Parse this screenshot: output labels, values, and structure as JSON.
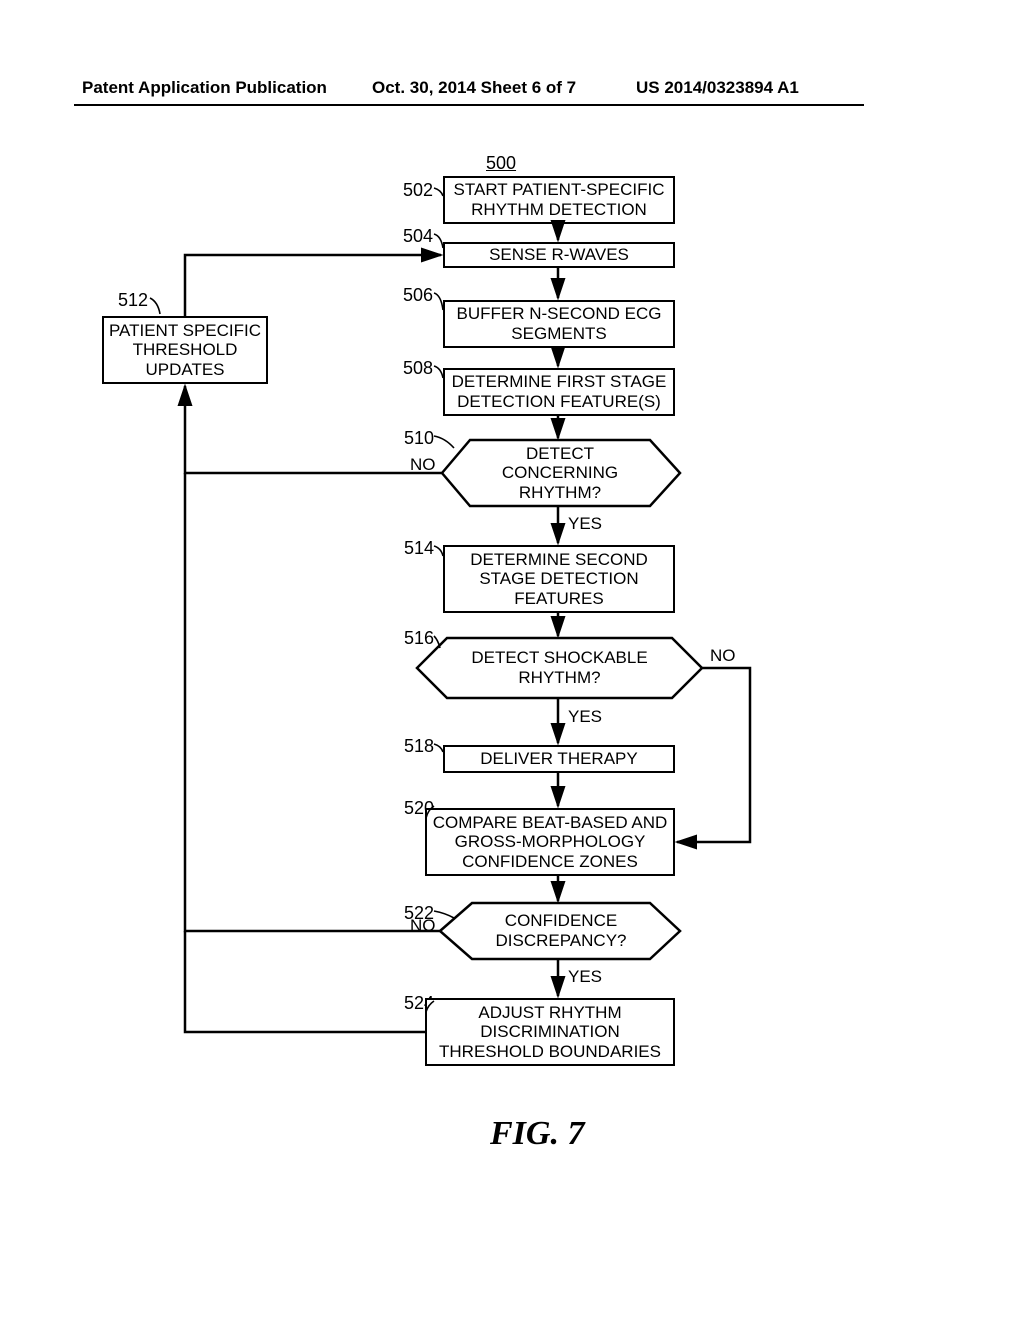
{
  "header": {
    "left": "Patent Application Publication",
    "center": "Oct. 30, 2014  Sheet 6 of 7",
    "right": "US 2014/0323894 A1"
  },
  "refs": {
    "r500": "500",
    "r502": "502",
    "r504": "504",
    "r506": "506",
    "r508": "508",
    "r510": "510",
    "r512": "512",
    "r514": "514",
    "r516": "516",
    "r518": "518",
    "r520": "520",
    "r522": "522",
    "r524": "524"
  },
  "boxes": {
    "b502": "START PATIENT-SPECIFIC RHYTHM DETECTION",
    "b504": "SENSE R-WAVES",
    "b506": "BUFFER N-SECOND ECG SEGMENTS",
    "b508": "DETERMINE FIRST STAGE DETECTION FEATURE(S)",
    "b510": "DETECT CONCERNING RHYTHM?",
    "b512": "PATIENT SPECIFIC THRESHOLD UPDATES",
    "b514": "DETERMINE SECOND STAGE DETECTION FEATURES",
    "b516": "DETECT SHOCKABLE RHYTHM?",
    "b518": "DELIVER THERAPY",
    "b520": "COMPARE BEAT-BASED AND GROSS-MORPHOLOGY CONFIDENCE ZONES",
    "b522": "CONFIDENCE DISCREPANCY?",
    "b524": "ADJUST RHYTHM DISCRIMINATION THRESHOLD BOUNDARIES"
  },
  "labels": {
    "yes": "YES",
    "no": "NO"
  },
  "figure": "FIG. 7"
}
